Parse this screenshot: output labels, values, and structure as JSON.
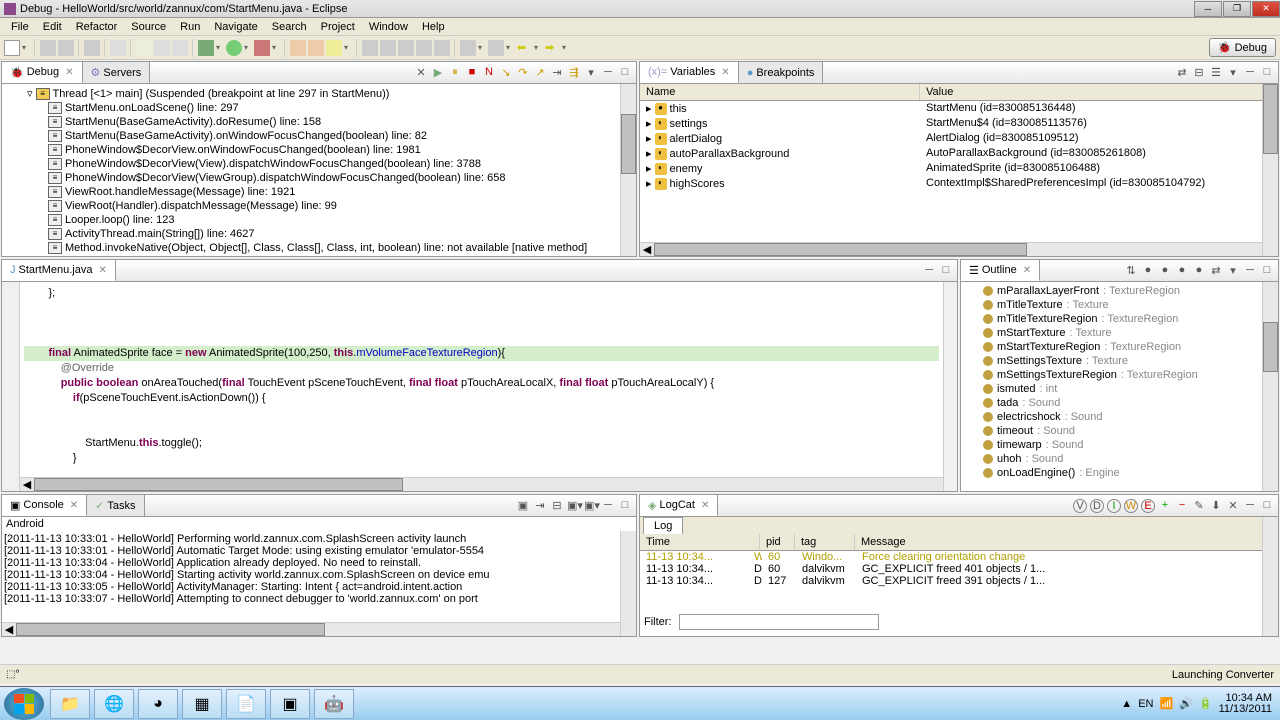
{
  "title": "Debug - HelloWorld/src/world/zannux/com/StartMenu.java - Eclipse",
  "menus": [
    "File",
    "Edit",
    "Refactor",
    "Source",
    "Run",
    "Navigate",
    "Search",
    "Project",
    "Window",
    "Help"
  ],
  "perspective": "Debug",
  "debug_view": {
    "tab1": "Debug",
    "tab2": "Servers",
    "thread_header": "Thread [<1> main] (Suspended (breakpoint at line 297 in StartMenu))",
    "frames": [
      "StartMenu.onLoadScene() line: 297",
      "StartMenu(BaseGameActivity).doResume() line: 158",
      "StartMenu(BaseGameActivity).onWindowFocusChanged(boolean) line: 82",
      "PhoneWindow$DecorView.onWindowFocusChanged(boolean) line: 1981",
      "PhoneWindow$DecorView(View).dispatchWindowFocusChanged(boolean) line: 3788",
      "PhoneWindow$DecorView(ViewGroup).dispatchWindowFocusChanged(boolean) line: 658",
      "ViewRoot.handleMessage(Message) line: 1921",
      "ViewRoot(Handler).dispatchMessage(Message) line: 99",
      "Looper.loop() line: 123",
      "ActivityThread.main(String[]) line: 4627",
      "Method.invokeNative(Object, Object[], Class, Class[], Class, int, boolean) line: not available [native method]"
    ]
  },
  "variables_view": {
    "tab1": "Variables",
    "tab2": "Breakpoints",
    "col_name": "Name",
    "col_value": "Value",
    "rows": [
      {
        "name": "this",
        "value": "StartMenu  (id=830085136448)"
      },
      {
        "name": "settings",
        "value": "StartMenu$4  (id=830085113576)"
      },
      {
        "name": "alertDialog",
        "value": "AlertDialog  (id=830085109512)"
      },
      {
        "name": "autoParallaxBackground",
        "value": "AutoParallaxBackground  (id=830085261808)"
      },
      {
        "name": "enemy",
        "value": "AnimatedSprite  (id=830085106488)"
      },
      {
        "name": "highScores",
        "value": "ContextImpl$SharedPreferencesImpl  (id=830085104792)"
      }
    ]
  },
  "editor": {
    "filename": "StartMenu.java",
    "line1": "        };",
    "line_hl": "        final AnimatedSprite face = new AnimatedSprite(100,250, this.mVolumeFaceTextureRegion){",
    "line_override": "            @Override",
    "line_method": "            public boolean onAreaTouched(final TouchEvent pSceneTouchEvent, final float pTouchAreaLocalX, final float pTouchAreaLocalY) {",
    "line_if": "                if(pSceneTouchEvent.isActionDown()) {",
    "line_toggle": "                    StartMenu.this.toggle();",
    "line_brace": "                }"
  },
  "outline": {
    "tab": "Outline",
    "items": [
      {
        "name": "mParallaxLayerFront",
        "type": "TextureRegion"
      },
      {
        "name": "mTitleTexture",
        "type": "Texture"
      },
      {
        "name": "mTitleTextureRegion",
        "type": "TextureRegion"
      },
      {
        "name": "mStartTexture",
        "type": "Texture"
      },
      {
        "name": "mStartTextureRegion",
        "type": "TextureRegion"
      },
      {
        "name": "mSettingsTexture",
        "type": "Texture"
      },
      {
        "name": "mSettingsTextureRegion",
        "type": "TextureRegion"
      },
      {
        "name": "ismuted",
        "type": "int"
      },
      {
        "name": "tada",
        "type": "Sound"
      },
      {
        "name": "electricshock",
        "type": "Sound"
      },
      {
        "name": "timeout",
        "type": "Sound"
      },
      {
        "name": "timewarp",
        "type": "Sound"
      },
      {
        "name": "uhoh",
        "type": "Sound"
      },
      {
        "name": "onLoadEngine()",
        "type": "Engine"
      }
    ]
  },
  "console": {
    "tab1": "Console",
    "tab2": "Tasks",
    "title": "Android",
    "lines": [
      "[2011-11-13 10:33:01 - HelloWorld] Performing world.zannux.com.SplashScreen activity launch",
      "[2011-11-13 10:33:01 - HelloWorld] Automatic Target Mode: using existing emulator 'emulator-5554",
      "[2011-11-13 10:33:04 - HelloWorld] Application already deployed. No need to reinstall.",
      "[2011-11-13 10:33:04 - HelloWorld] Starting activity world.zannux.com.SplashScreen on device emu",
      "[2011-11-13 10:33:05 - HelloWorld] ActivityManager: Starting: Intent { act=android.intent.action",
      "[2011-11-13 10:33:07 - HelloWorld] Attempting to connect debugger to 'world.zannux.com' on port"
    ]
  },
  "logcat": {
    "tab": "LogCat",
    "logtab": "Log",
    "cols": {
      "time": "Time",
      "pid": "pid",
      "tag": "tag",
      "msg": "Message"
    },
    "rows": [
      {
        "time": "11-13 10:34...",
        "level": "W",
        "pid": "60",
        "tag": "Windo...",
        "msg": "Force clearing orientation change",
        "color": "#b0a000"
      },
      {
        "time": "11-13 10:34...",
        "level": "D",
        "pid": "60",
        "tag": "dalvikvm",
        "msg": "GC_EXPLICIT freed 401 objects / 1...",
        "color": "#000"
      },
      {
        "time": "11-13 10:34...",
        "level": "D",
        "pid": "127",
        "tag": "dalvikvm",
        "msg": "GC_EXPLICIT freed 391 objects / 1...",
        "color": "#000"
      }
    ],
    "filter_label": "Filter:"
  },
  "status": {
    "right": "Launching Converter"
  },
  "tray": {
    "lang": "EN",
    "time": "10:34 AM",
    "date": "11/13/2011"
  }
}
